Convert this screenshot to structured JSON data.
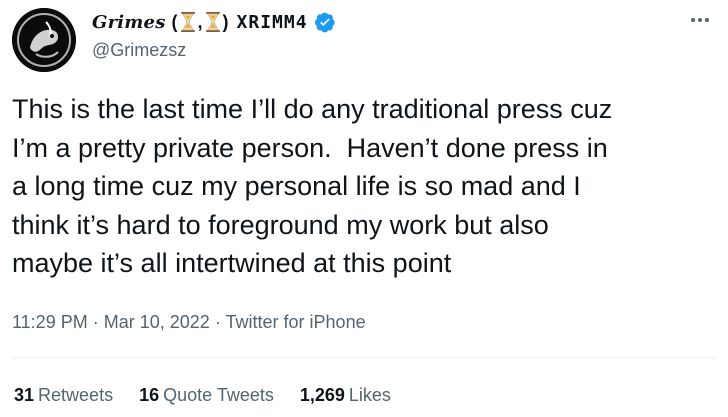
{
  "author": {
    "display_name_prefix": "Grimes",
    "open_paren": "(",
    "separator": ",",
    "close_paren": ")",
    "runes_name": "XRIMM4",
    "handle": "@Grimezsz",
    "verified_color": "#1d9bf0",
    "hourglass_color": "#e8b23a"
  },
  "tweet": {
    "text": "This is the last time I’ll do any traditional press cuz\nI’m a pretty private person.  Haven’t done press in\na long time cuz my personal life is so mad and I\nthink it’s hard to foreground my work but also\nmaybe it’s all intertwined at this point",
    "time": "11:29 PM",
    "dot1": "·",
    "date": "Mar 10, 2022",
    "dot2": "·",
    "source": "Twitter for iPhone"
  },
  "stats": {
    "retweets_count": "31",
    "retweets_label": "Retweets",
    "quotes_count": "16",
    "quotes_label": "Quote Tweets",
    "likes_count": "1,269",
    "likes_label": "Likes"
  },
  "icons": {
    "avatar": "avatar-image",
    "verified": "verified-badge-icon",
    "hourglass": "hourglass-emoji-icon",
    "more": "more-options-icon"
  }
}
